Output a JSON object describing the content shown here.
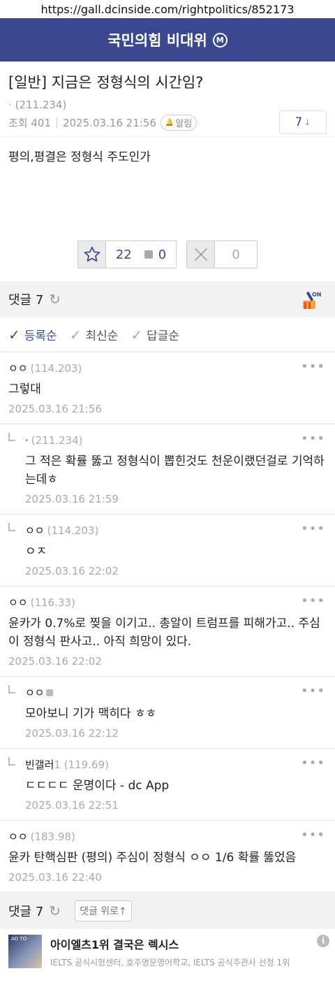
{
  "browser": {
    "url": "https://gall.dcinside.com/rightpolitics/852173"
  },
  "gallery": {
    "title": "국민의힘 비대위",
    "badge": "M"
  },
  "post": {
    "title": "[일반] 지금은 정형식의 시간임?",
    "author_name": "·",
    "author_ip": "(211.234)",
    "views": "조회 401",
    "date": "2025.03.16 21:56",
    "alarm_label": "알림",
    "comment_count": "7",
    "body": "평의,평결은 정형식 주도인가",
    "upvotes": "22",
    "fixed_upvotes": "0",
    "downvotes": "0"
  },
  "comments_header": {
    "label": "댓글 7"
  },
  "sort_options": [
    {
      "label": "등록순",
      "active": true
    },
    {
      "label": "최신순",
      "active": false
    },
    {
      "label": "답글순",
      "active": false
    }
  ],
  "comments": [
    {
      "author": "ㅇㅇ",
      "ip": "(114.203)",
      "text": "그렇대",
      "date": "2025.03.16 21:56"
    },
    {
      "author": "·",
      "ip": "(211.234)",
      "text": "그 적은 확률 뚫고 정형식이 뽑힌것도 천운이랬던걸로 기억하는데ㅎ",
      "date": "2025.03.16 21:59"
    },
    {
      "author": "ㅇㅇ",
      "ip": "(114.203)",
      "text": "ㅇㅈ",
      "date": "2025.03.16 22:02"
    },
    {
      "author": "ㅇㅇ",
      "ip": "(116.33)",
      "text": "윤카가 0.7%로 찢을 이기고.. 총알이 트럼프를 피해가고.. 주심이 정형식 판사고.. 아직 희망이 있다.",
      "date": "2025.03.16 22:02"
    },
    {
      "author": "ㅇㅇ",
      "ip": "",
      "text": "모아보니 기가 맥히다 ㅎㅎ",
      "date": "2025.03.16 22:12"
    },
    {
      "author": "빈갤러",
      "ip": "1 (119.69)",
      "text": "ㄷㄷㄷㄷ 운명이다 - dc App",
      "date": "2025.03.16 22:51"
    },
    {
      "author": "ㅇㅇ",
      "ip": "(183.98)",
      "text": "윤카 탄핵심판 (평의) 주심이 정형식 ㅇㅇ 1/6 확률 뚫었음",
      "date": "2025.03.16 22:40"
    }
  ],
  "comments_footer": {
    "label": "댓글 7",
    "go_top": "댓글 위로↑"
  },
  "ad": {
    "title": "아이엘츠1위 결국은 렉시스",
    "subtitle": "IELTS 공식시험센터, 호주명문영어학교, IELTS 공식주관사 선정 1위",
    "thumb_text": "AD TO"
  },
  "colors": {
    "brand": "#3b4890",
    "muted": "#aaaaaa"
  }
}
